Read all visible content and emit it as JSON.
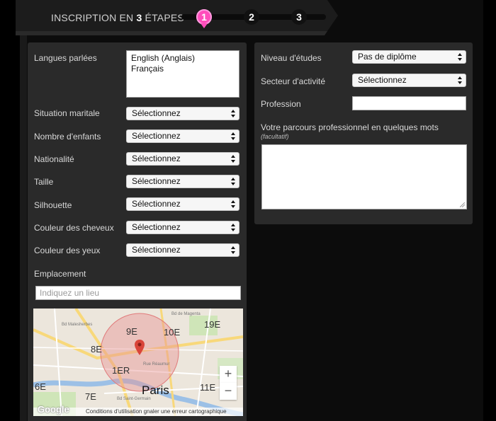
{
  "header": {
    "title_prefix": "INSCRIPTION EN ",
    "title_number": "3",
    "title_suffix": " ÉTAPES",
    "steps": [
      {
        "label": "1",
        "active": true
      },
      {
        "label": "2",
        "active": false
      },
      {
        "label": "3",
        "active": false
      }
    ],
    "accent": "#ff4dbb"
  },
  "left": {
    "languages_label": "Langues parlées",
    "languages_options": [
      "English (Anglais)",
      "Français"
    ],
    "marital_label": "Situation maritale",
    "marital_value": "Sélectionnez",
    "children_label": "Nombre d'enfants",
    "children_value": "Sélectionnez",
    "nationality_label": "Nationalité",
    "nationality_value": "Sélectionnez",
    "height_label": "Taille",
    "height_value": "Sélectionnez",
    "silhouette_label": "Silhouette",
    "silhouette_value": "Sélectionnez",
    "hair_label": "Couleur des cheveux",
    "hair_value": "Sélectionnez",
    "eyes_label": "Couleur des yeux",
    "eyes_value": "Sélectionnez",
    "location_label": "Emplacement",
    "location_placeholder": "Indiquez un lieu"
  },
  "map": {
    "city": "Paris",
    "districts": [
      "9E",
      "10E",
      "19E",
      "8E",
      "1ER",
      "11E",
      "6E",
      "7E"
    ],
    "street_beaumur": "Rue Réaumur",
    "street_malesherbes": "Bd Malesherbes",
    "street_st_germain": "Bd Saint-Germain",
    "street_magenta": "Bd de Magenta",
    "zoom_in": "+",
    "zoom_out": "−",
    "brand": "Google",
    "footer": "Conditions d'utilisation   gnaler une erreur cartographique"
  },
  "right": {
    "education_label": "Niveau d'études",
    "education_value": "Pas de diplôme",
    "sector_label": "Secteur d'activité",
    "sector_value": "Sélectionnez",
    "profession_label": "Profession",
    "profession_value": "",
    "career_label": "Votre parcours professionnel en quelques mots",
    "career_optional": "(facultatif)",
    "career_value": ""
  }
}
